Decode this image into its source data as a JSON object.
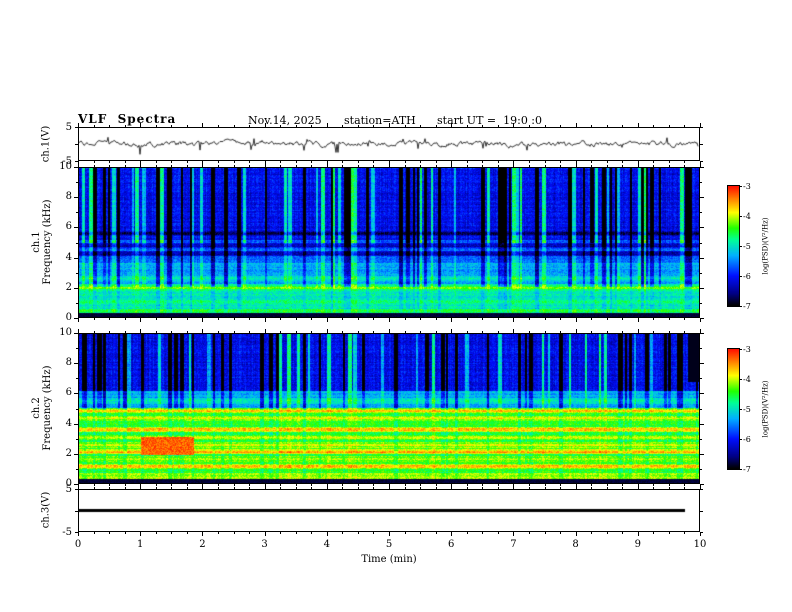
{
  "title": {
    "main": "VLF  Spectra",
    "date": "Nov.14, 2025",
    "station": "station=ATH",
    "start_ut": "start UT =  19:0 :0"
  },
  "x_axis": {
    "label": "Time  (min)",
    "min": 0,
    "max": 10,
    "major_ticks": [
      0,
      1,
      2,
      3,
      4,
      5,
      6,
      7,
      8,
      9,
      10
    ],
    "tick_labels": [
      "0",
      "1",
      "2",
      "3",
      "4",
      "5",
      "6",
      "7",
      "8",
      "9",
      "10"
    ]
  },
  "panels": {
    "ch1_wave": {
      "name": "ch.1(V)",
      "ylim": [
        -5,
        5
      ],
      "y_tick_values": [
        5,
        -5
      ],
      "y_tick_labels": [
        "5",
        "-5"
      ]
    },
    "ch1_spec": {
      "name_line1": "ch.1",
      "name_line2": "Frequency (kHz)",
      "ylim": [
        0,
        10
      ],
      "y_tick_values": [
        0,
        2,
        4,
        6,
        8,
        10
      ],
      "y_tick_labels": [
        "0",
        "2",
        "4",
        "6",
        "8",
        "10"
      ]
    },
    "ch2_spec": {
      "name_line1": "ch.2",
      "name_line2": "Frequency (kHz)",
      "ylim": [
        0,
        10
      ],
      "y_tick_values": [
        0,
        2,
        4,
        6,
        8,
        10
      ],
      "y_tick_labels": [
        "0",
        "2",
        "4",
        "6",
        "8",
        "10"
      ]
    },
    "ch3_wave": {
      "name": "ch.3(V)",
      "ylim": [
        -5,
        5
      ],
      "y_tick_values": [
        5,
        -5
      ],
      "y_tick_labels": [
        "5",
        "-5"
      ]
    }
  },
  "colorbar": {
    "label": "log(PSD)(V²/Hz)",
    "range": [
      -7,
      -3
    ],
    "tick_labels": [
      "-3",
      "-4",
      "-5",
      "-6",
      "-7"
    ],
    "stops": [
      "#000000",
      "#000085",
      "#0010ff",
      "#00b0ff",
      "#00ff99",
      "#22ff00",
      "#ffff00",
      "#ff8800",
      "#ff1100"
    ],
    "positions": [
      0,
      0.1,
      0.25,
      0.42,
      0.55,
      0.65,
      0.78,
      0.89,
      1
    ]
  },
  "chart_data": [
    {
      "id": "ch1_waveform",
      "type": "line",
      "ylabel": "ch.1(V)",
      "xlabel": "Time (min)",
      "xlim": [
        0,
        10
      ],
      "ylim": [
        -5,
        5
      ],
      "mean_v": 0,
      "envelope_v": 1,
      "summary": "Broadband noise fluctuating about 0 V with roughly ±1 V envelope and intermittent impulsive spikes reaching about -4 V"
    },
    {
      "id": "ch1_spectrogram",
      "type": "heatmap",
      "ylabel": "ch.1 Frequency (kHz)",
      "xlabel": "Time (min)",
      "zlabel": "log(PSD)(V²/Hz)",
      "xlim": [
        0,
        10
      ],
      "ylim": [
        0,
        10
      ],
      "zlim": [
        -7,
        -3
      ],
      "base_bands": [
        [
          0,
          0.25,
          -7
        ],
        [
          0.25,
          0.55,
          -4.6
        ],
        [
          0.55,
          2.2,
          -5.0
        ],
        [
          2.2,
          3.6,
          -5.3
        ],
        [
          3.6,
          5.2,
          -5.7
        ],
        [
          5.2,
          10.01,
          -6.1
        ]
      ],
      "spectral_lines": [
        [
          1.05,
          -4.8
        ],
        [
          1.55,
          -4.9
        ],
        [
          1.95,
          -4.3
        ],
        [
          2.6,
          -5.0
        ],
        [
          3.15,
          -5.4
        ],
        [
          4.25,
          -6.5
        ],
        [
          4.8,
          -6.4
        ],
        [
          5.6,
          -6.7
        ]
      ],
      "streaks": {
        "above_khz": 2,
        "full_above_khz": 5,
        "density_per_min": 9,
        "dark_psd": -7,
        "bright_psd": -4.8
      },
      "summary": "Dark-blue background (-6) above 5 kHz cut by dense vertical sferic streaks alternating near-black (-7) and cyan-green (-5); cyan band 0.5-2 kHz; thin bright line near 2 kHz; black band below 0.25 kHz"
    },
    {
      "id": "ch2_spectrogram",
      "type": "heatmap",
      "ylabel": "ch.2 Frequency (kHz)",
      "xlabel": "Time (min)",
      "zlabel": "log(PSD)(V²/Hz)",
      "xlim": [
        0,
        10
      ],
      "ylim": [
        0,
        10
      ],
      "zlim": [
        -7,
        -3
      ],
      "base_bands": [
        [
          0,
          0.3,
          -7
        ],
        [
          0.3,
          0.65,
          -4.1
        ],
        [
          0.65,
          2.0,
          -4.5
        ],
        [
          2.0,
          5.0,
          -4.5
        ],
        [
          5.0,
          6.2,
          -5.3
        ],
        [
          6.2,
          10.01,
          -6.1
        ]
      ],
      "spectral_lines": [
        [
          1.1,
          -3.7
        ],
        [
          1.6,
          -4.1
        ],
        [
          2.1,
          -3.5
        ],
        [
          2.55,
          -3.9
        ],
        [
          3.05,
          -4.0
        ],
        [
          3.6,
          -3.6
        ],
        [
          4.35,
          -3.9
        ],
        [
          4.85,
          -3.6
        ],
        [
          5.5,
          -4.9
        ]
      ],
      "streaks": {
        "above_khz": 5,
        "full_above_khz": 6.2,
        "density_per_min": 9,
        "dark_psd": -7,
        "bright_psd": -4.8
      },
      "patch": {
        "t": [
          1.0,
          1.85
        ],
        "f": [
          1.9,
          3.1
        ],
        "psd": -3.3
      },
      "gap": {
        "t": [
          9.82,
          10
        ],
        "f": [
          6.8,
          10
        ],
        "psd": -7
      },
      "summary": "Green/yellow (-4.5) background 0.7-5 kHz with several orange/red horizontal lines (-3.5); strong red patch near t=1-1.8 min around 2-3 kHz; dark-blue streaked region above 6 kHz; black band below 0.3 kHz; black notch at far right above 7 kHz"
    },
    {
      "id": "ch3_waveform",
      "type": "line",
      "ylabel": "ch.3(V)",
      "xlabel": "Time (min)",
      "xlim": [
        0,
        10
      ],
      "ylim": [
        -5,
        5
      ],
      "constant_value": 0,
      "summary": "Flat thick line at 0 V across the entire record"
    }
  ]
}
